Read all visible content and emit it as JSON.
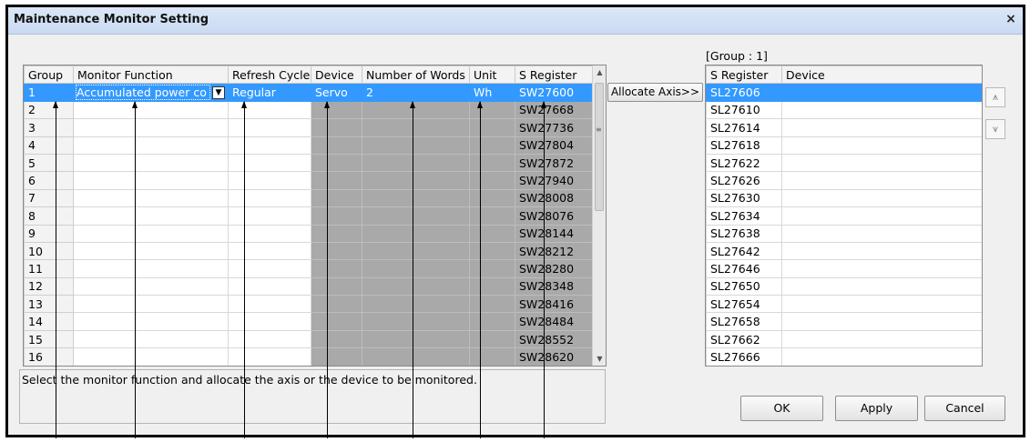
{
  "window": {
    "title": "Maintenance Monitor Setting",
    "close": "×"
  },
  "main_table": {
    "headers": [
      "Group",
      "Monitor Function",
      "Refresh Cycle",
      "Device",
      "Number of Words",
      "Unit",
      "S Register"
    ],
    "selected_row": {
      "group": "1",
      "monitor_function": "Accumulated power co",
      "refresh_cycle": "Regular",
      "device": "Servo",
      "words": "2",
      "unit": "Wh",
      "sreg": "SW27600"
    },
    "rows": [
      [
        "2",
        "SW27668"
      ],
      [
        "3",
        "SW27736"
      ],
      [
        "4",
        "SW27804"
      ],
      [
        "5",
        "SW27872"
      ],
      [
        "6",
        "SW27940"
      ],
      [
        "7",
        "SW28008"
      ],
      [
        "8",
        "SW28076"
      ],
      [
        "9",
        "SW28144"
      ],
      [
        "10",
        "SW28212"
      ],
      [
        "11",
        "SW28280"
      ],
      [
        "12",
        "SW28348"
      ],
      [
        "13",
        "SW28416"
      ],
      [
        "14",
        "SW28484"
      ],
      [
        "15",
        "SW28552"
      ],
      [
        "16",
        "SW28620"
      ]
    ]
  },
  "allocate_button": "Allocate Axis>>",
  "right_panel": {
    "group_label": "[Group : 1]",
    "headers": [
      "S Register",
      "Device"
    ],
    "rows": [
      "SL27606",
      "SL27610",
      "SL27614",
      "SL27618",
      "SL27622",
      "SL27626",
      "SL27630",
      "SL27634",
      "SL27638",
      "SL27642",
      "SL27646",
      "SL27650",
      "SL27654",
      "SL27658",
      "SL27662",
      "SL27666"
    ]
  },
  "status_text": "Select the monitor function and allocate the axis or the device to be monitored.",
  "buttons": {
    "ok": "OK",
    "apply": "Apply",
    "cancel": "Cancel"
  },
  "icons": {
    "move_up": "move-up-icon",
    "move_down": "move-down-icon",
    "combo": "chevron-down-icon"
  }
}
